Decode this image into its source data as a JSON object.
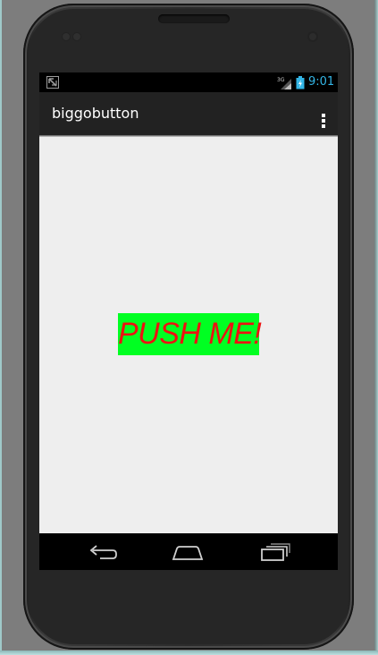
{
  "status_bar": {
    "network_type": "3G",
    "time": "9:01",
    "icons": [
      "debug-notification-icon",
      "signal-icon",
      "battery-charging-icon"
    ]
  },
  "app": {
    "title": "biggobutton"
  },
  "main": {
    "button_label": "PUSH ME!"
  },
  "nav_bar": {
    "icons": [
      "back-icon",
      "home-icon",
      "recents-icon"
    ]
  },
  "colors": {
    "button_background": "#00ff22",
    "button_text": "#ee1111",
    "action_bar": "#222222",
    "content_background": "#eeeeee",
    "clock": "#33b5e5"
  }
}
